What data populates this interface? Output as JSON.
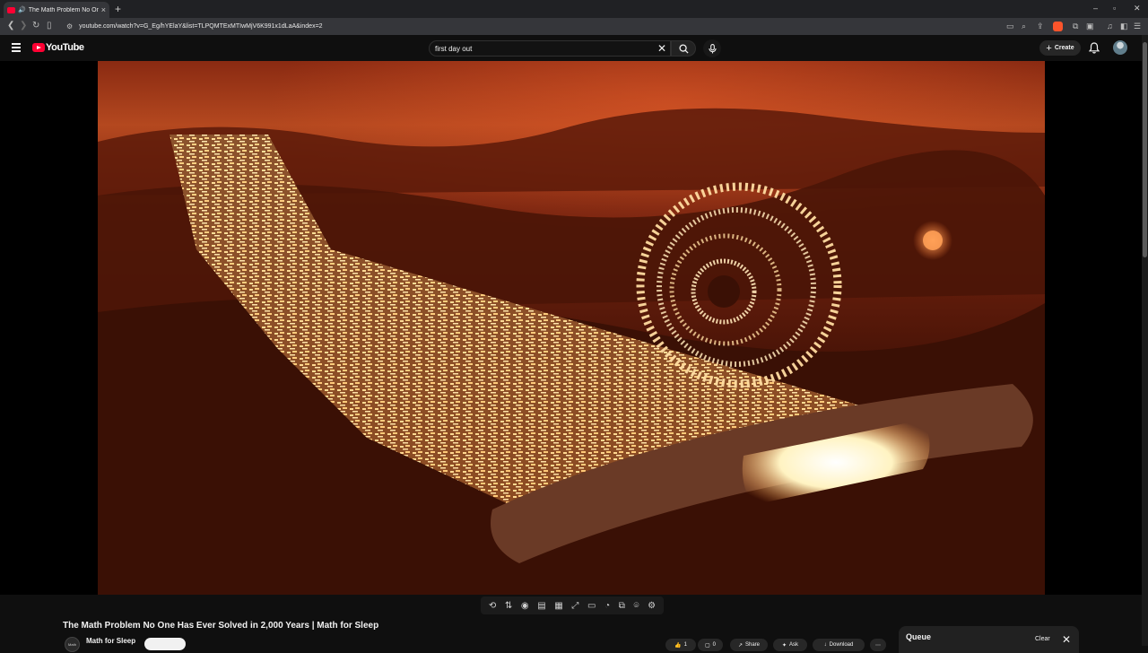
{
  "browser": {
    "tab_title": "The Math Problem No One H",
    "new_tab": "+",
    "url": "youtube.com/watch?v=G_Eg/hYElaY&list=TLPQMTExMTIwMjV6K991x1dLaA&index=2",
    "window_controls": [
      "–",
      "▫",
      "✕"
    ]
  },
  "youtube": {
    "logo_text": "YouTube",
    "search": {
      "value": "first day out",
      "placeholder": "Search"
    },
    "create_label": "Create"
  },
  "video": {
    "title": "The Math Problem No One Has Ever Solved in 2,000 Years | Math for Sleep",
    "channel": "Math for Sleep",
    "channel_avatar_text": "Math"
  },
  "actions": {
    "like": "1",
    "dislike": "",
    "comments": "0",
    "share": "Share",
    "ask": "Ask",
    "download": "Download"
  },
  "queue": {
    "title": "Queue",
    "clear": "Clear"
  }
}
